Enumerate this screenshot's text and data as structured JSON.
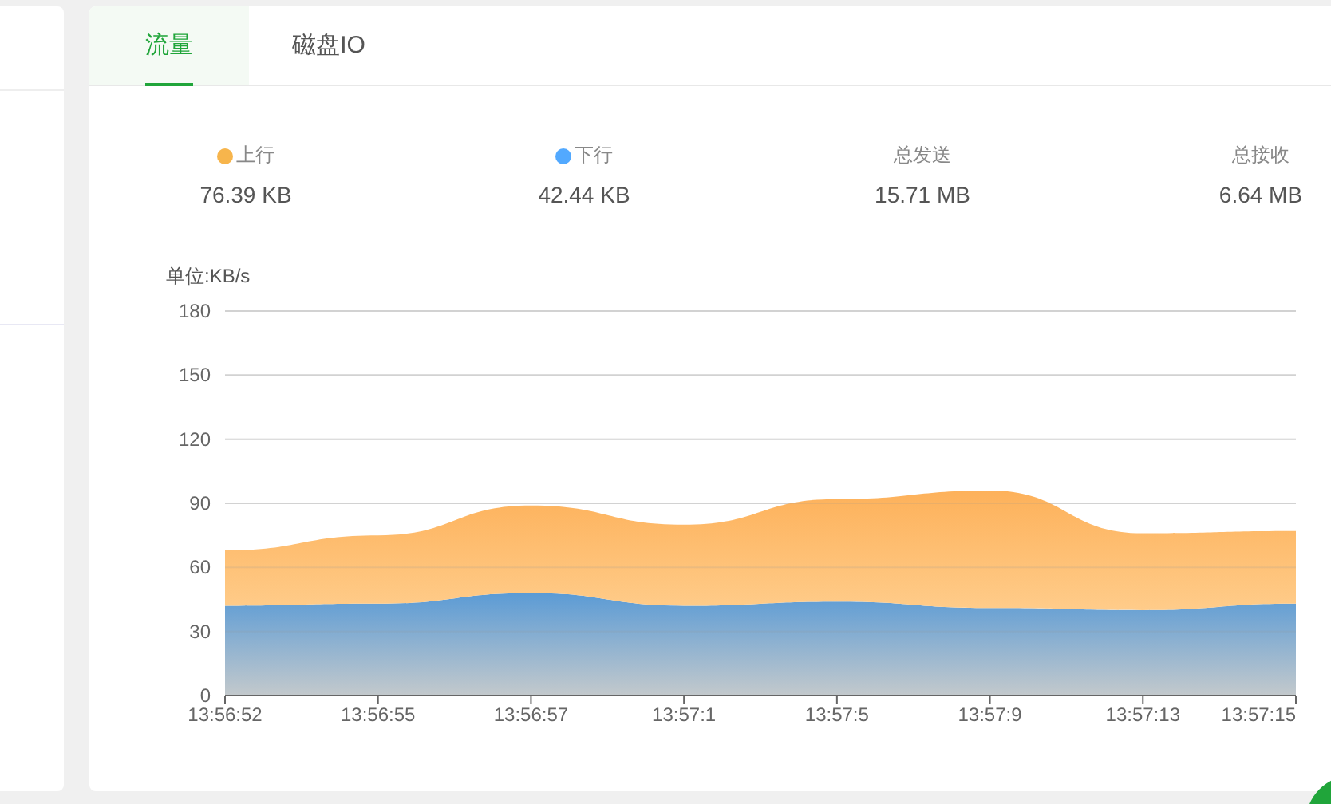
{
  "tabs": [
    {
      "label": "流量",
      "selected": true
    },
    {
      "label": "磁盘IO",
      "selected": false
    }
  ],
  "stats": [
    {
      "kind": "legend",
      "value": "76.39 KB",
      "color": "#f7b54c"
    },
    {
      "kind": "legend",
      "value": "42.44 KB",
      "color": "#52a9ff"
    },
    {
      "kind": "total",
      "label": "总发送",
      "value": "15.71 MB"
    },
    {
      "kind": "total",
      "label": "总接收",
      "value": "6.64 MB"
    }
  ],
  "chart_data": {
    "type": "area",
    "stacked": true,
    "grid": true,
    "ylabel": "单位:KB/s",
    "categories": [
      "13:56:52",
      "13:56:55",
      "13:56:57",
      "13:57:1",
      "13:57:5",
      "13:57:9",
      "13:57:13",
      "13:57:15"
    ],
    "ylim": [
      0,
      180
    ],
    "yticks": [
      0,
      30,
      60,
      90,
      120,
      150,
      180
    ],
    "series": [
      {
        "name": "上行",
        "color": "#fdb15a",
        "values": [
          26,
          32,
          41,
          38,
          48,
          55,
          36,
          34
        ]
      },
      {
        "name": "下行",
        "color": "#5b9bd5",
        "values": [
          42,
          43,
          48,
          42,
          44,
          41,
          40,
          43
        ]
      }
    ]
  }
}
